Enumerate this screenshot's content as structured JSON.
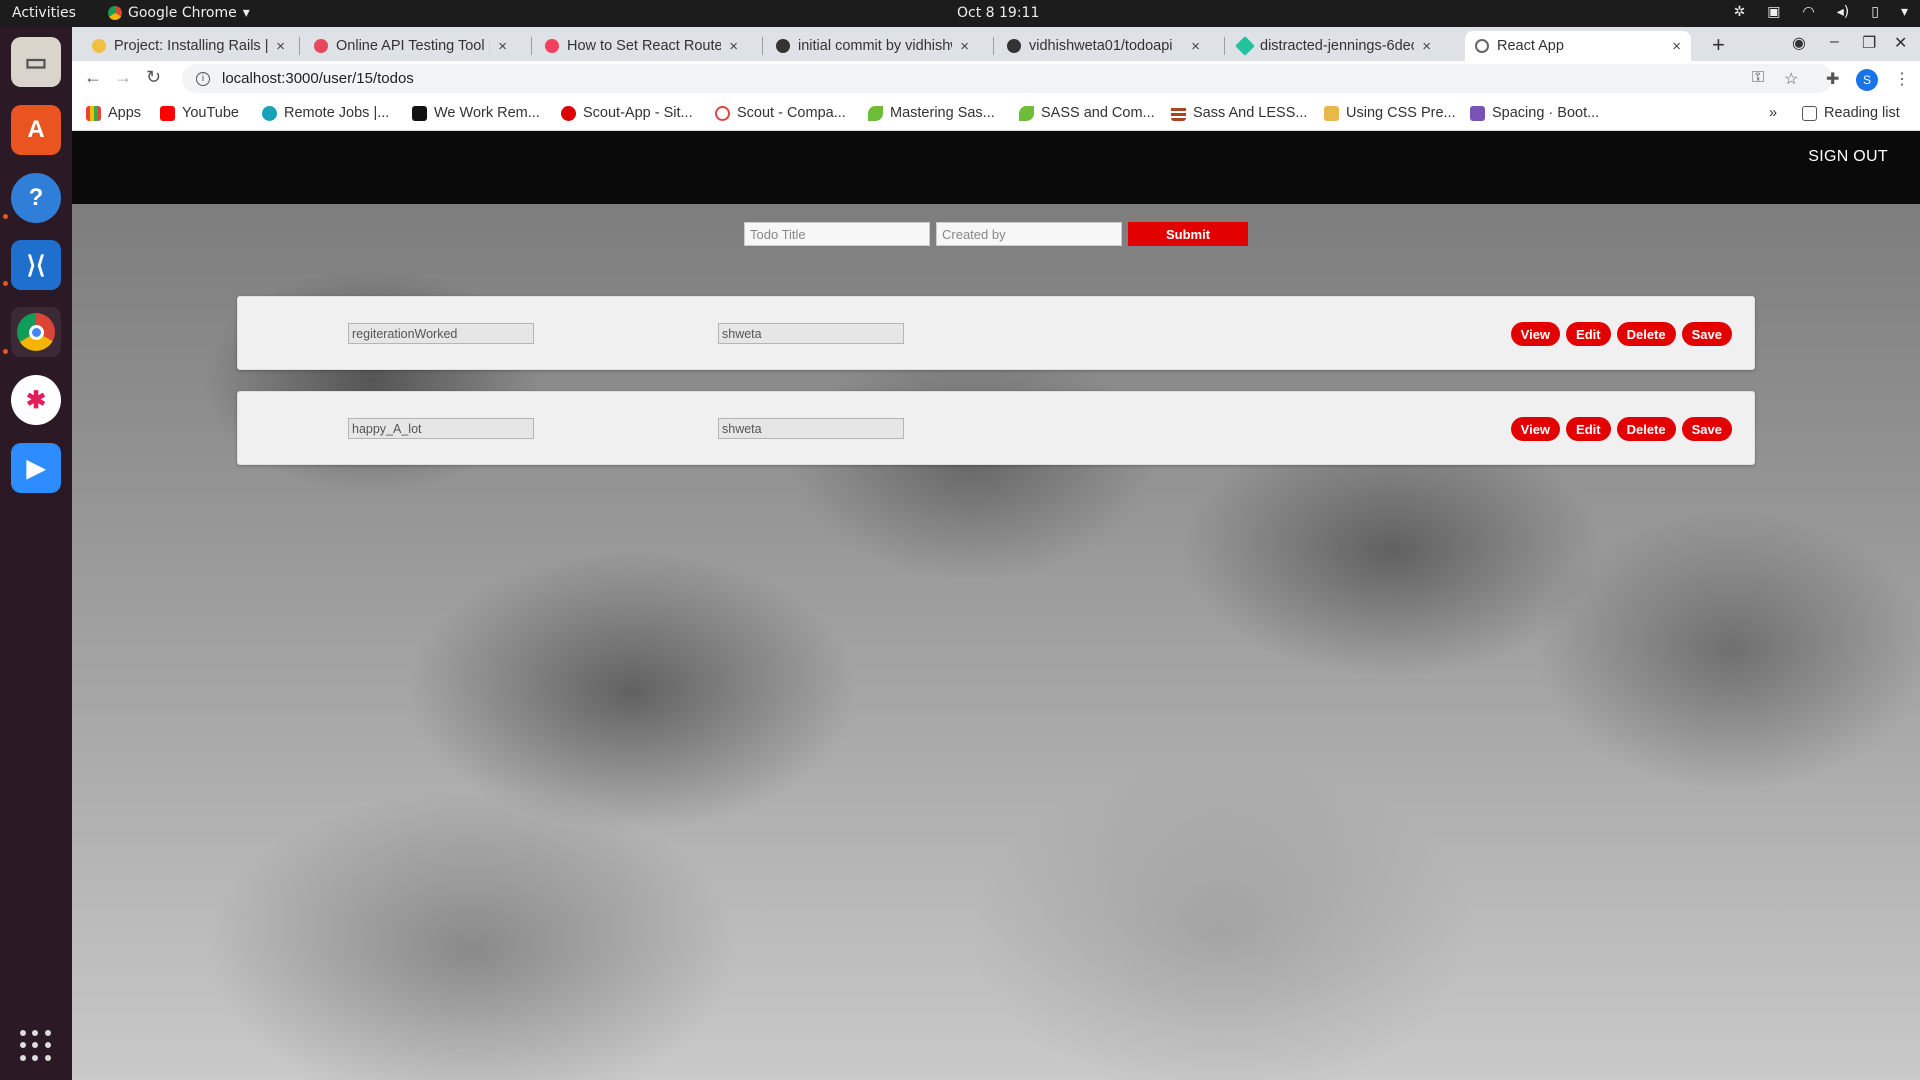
{
  "system": {
    "activities": "Activities",
    "app_name": "Google Chrome",
    "clock": "Oct 8  19:11"
  },
  "browser": {
    "tabs": [
      {
        "title": "Project: Installing Rails |",
        "active": false
      },
      {
        "title": "Online API Testing Tool |",
        "active": false
      },
      {
        "title": "How to Set React Router",
        "active": false
      },
      {
        "title": "initial commit by vidhishw",
        "active": false
      },
      {
        "title": "vidhishweta01/todoapi",
        "active": false
      },
      {
        "title": "distracted-jennings-6dec",
        "active": false
      },
      {
        "title": "React App",
        "active": true
      }
    ],
    "url": "localhost:3000/user/15/todos",
    "profile_initial": "S",
    "bookmarks": [
      {
        "label": "Apps"
      },
      {
        "label": "YouTube"
      },
      {
        "label": "Remote Jobs |..."
      },
      {
        "label": "We Work Rem..."
      },
      {
        "label": "Scout-App - Sit..."
      },
      {
        "label": "Scout - Compa..."
      },
      {
        "label": "Mastering Sas..."
      },
      {
        "label": "SASS and Com..."
      },
      {
        "label": "Sass And LESS..."
      },
      {
        "label": "Using CSS Pre..."
      },
      {
        "label": "Spacing · Boot..."
      }
    ],
    "reading_list": "Reading list"
  },
  "app": {
    "signout_label": "SIGN OUT",
    "form": {
      "title_placeholder": "Todo Title",
      "created_by_placeholder": "Created by",
      "submit_label": "Submit"
    },
    "todos": [
      {
        "title": "regiterationWorked",
        "created_by": "shweta"
      },
      {
        "title": "happy_A_lot",
        "created_by": "shweta"
      }
    ],
    "actions": {
      "view": "View",
      "edit": "Edit",
      "delete": "Delete",
      "save": "Save"
    }
  },
  "colors": {
    "accent_red": "#e30000",
    "nav_black": "#0a0a0a"
  }
}
